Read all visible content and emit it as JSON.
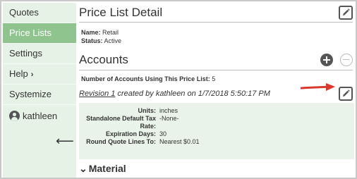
{
  "sidebar": {
    "items": [
      {
        "label": "Quotes"
      },
      {
        "label": "Price Lists"
      },
      {
        "label": "Settings"
      },
      {
        "label": "Help",
        "chevron": "›"
      },
      {
        "label": "Systemize"
      }
    ],
    "user": {
      "name": "kathleen",
      "icon": "user-icon"
    },
    "collapse_icon": "⟵"
  },
  "detail": {
    "title": "Price List Detail",
    "name_label": "Name:",
    "name_value": "Retail",
    "status_label": "Status:",
    "status_value": "Active"
  },
  "accounts": {
    "title": "Accounts",
    "count_label": "Number of Accounts Using This Price List:",
    "count_value": "5"
  },
  "revision": {
    "link_text": "Revision 1",
    "rest_text": " created by kathleen on 1/7/2018 5:50:17 PM"
  },
  "details": [
    {
      "label": "Units:",
      "value": "inches"
    },
    {
      "label": "Standalone Default Tax Rate:",
      "value": "-None-"
    },
    {
      "label": "Expiration Days:",
      "value": "30"
    },
    {
      "label": "Round Quote Lines To:",
      "value": "Nearest $0.01"
    }
  ],
  "material": {
    "chevron": "⌄",
    "label": "Material"
  },
  "colors": {
    "sidebar_bg": "#e6f2e6",
    "active_bg": "#8fc48f",
    "details_bg": "#e9f3e9",
    "arrow": "#d9382e"
  }
}
